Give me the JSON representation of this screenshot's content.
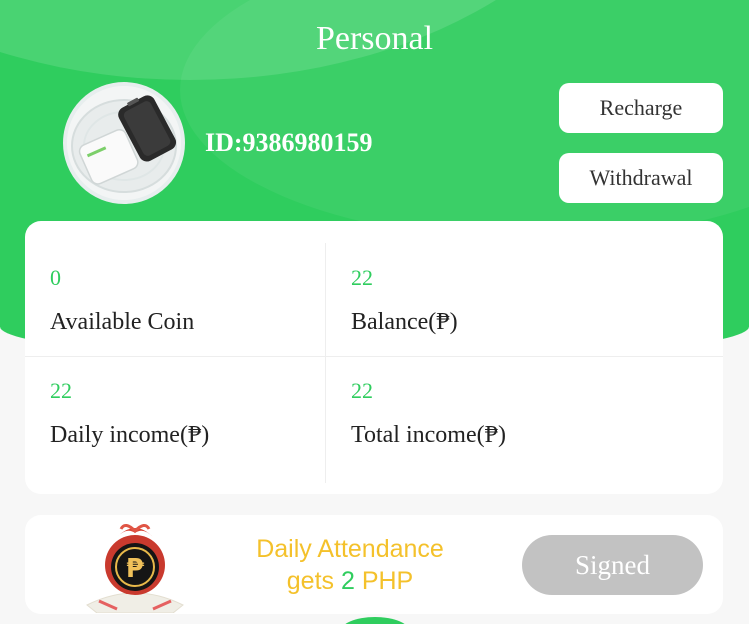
{
  "header": {
    "title": "Personal",
    "user_id": "ID:9386980159",
    "recharge_label": "Recharge",
    "withdrawal_label": "Withdrawal"
  },
  "stats": [
    {
      "value": "0",
      "label": "Available Coin"
    },
    {
      "value": "22",
      "label": "Balance(₱)"
    },
    {
      "value": "22",
      "label": "Daily income(₱)"
    },
    {
      "value": "22",
      "label": "Total income(₱)"
    }
  ],
  "attendance": {
    "line1": "Daily Attendance",
    "line2_prefix": "gets ",
    "amount": "2",
    "line2_suffix": " PHP",
    "button_label": "Signed",
    "gift_symbol": "₱"
  },
  "colors": {
    "accent": "#2fcd5e",
    "attendance_text": "#f4c12b",
    "signed_button": "#c2c2c2"
  },
  "icons": {
    "avatar": "device-product-photo",
    "gift": "gift-coin-icon"
  }
}
